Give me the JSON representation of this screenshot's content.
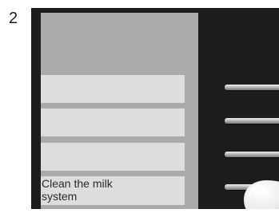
{
  "step_number": "2",
  "screen": {
    "menu_items": [
      {
        "label": ""
      },
      {
        "label": ""
      },
      {
        "label": ""
      },
      {
        "label": "Clean the milk system"
      }
    ]
  },
  "colors": {
    "panel_background": "#1d1d1d",
    "screen_background": "#a9aaac",
    "menu_item_background": "#dcdddf",
    "text": "#2a2a2a"
  },
  "icons": {
    "side_buttons": "chrome-side-button",
    "pointer": "finger-press-icon"
  }
}
